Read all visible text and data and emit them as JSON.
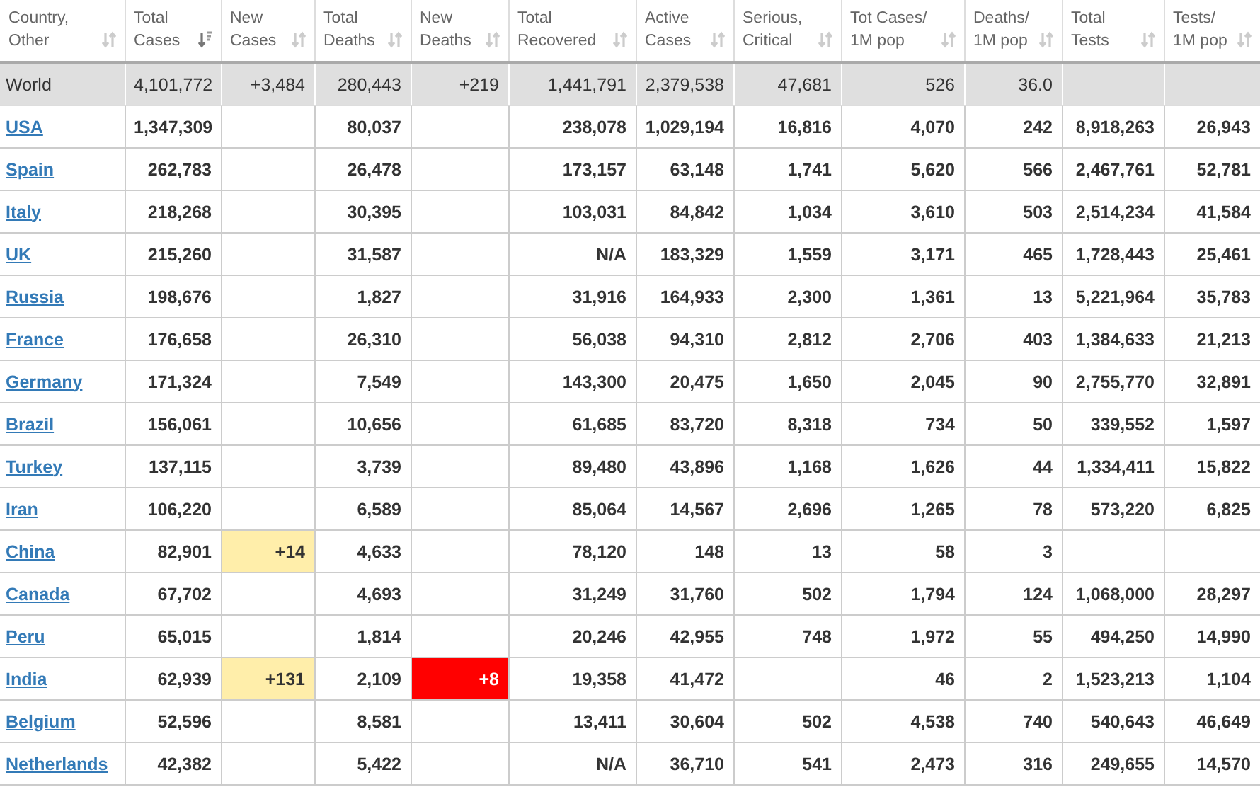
{
  "table": {
    "columns": [
      {
        "label": "Country,\nOther",
        "sorted": false
      },
      {
        "label": "Total\nCases",
        "sorted": true
      },
      {
        "label": "New\nCases",
        "sorted": false
      },
      {
        "label": "Total\nDeaths",
        "sorted": false
      },
      {
        "label": "New\nDeaths",
        "sorted": false
      },
      {
        "label": "Total\nRecovered",
        "sorted": false
      },
      {
        "label": "Active\nCases",
        "sorted": false
      },
      {
        "label": "Serious,\nCritical",
        "sorted": false
      },
      {
        "label": "Tot Cases/\n1M pop",
        "sorted": false
      },
      {
        "label": "Deaths/\n1M pop",
        "sorted": false
      },
      {
        "label": "Total\nTests",
        "sorted": false
      },
      {
        "label": "Tests/\n1M pop",
        "sorted": false
      }
    ],
    "rows": [
      {
        "kind": "world",
        "country": "World",
        "total_cases": "4,101,772",
        "new_cases": "+3,484",
        "total_deaths": "280,443",
        "new_deaths": "+219",
        "total_recovered": "1,441,791",
        "active_cases": "2,379,538",
        "serious_critical": "47,681",
        "tot_cases_per_1m": "526",
        "deaths_per_1m": "36.0",
        "new_cases_highlight": false,
        "new_deaths_highlight": false
      },
      {
        "kind": "country",
        "country": "USA",
        "total_cases": "1,347,309",
        "total_deaths": "80,037",
        "total_recovered": "238,078",
        "active_cases": "1,029,194",
        "serious_critical": "16,816",
        "tot_cases_per_1m": "4,070",
        "deaths_per_1m": "242",
        "total_tests": "8,918,263",
        "tests_per_1m": "26,943",
        "new_cases_highlight": false,
        "new_deaths_highlight": false
      },
      {
        "kind": "country",
        "country": "Spain",
        "total_cases": "262,783",
        "total_deaths": "26,478",
        "total_recovered": "173,157",
        "active_cases": "63,148",
        "serious_critical": "1,741",
        "tot_cases_per_1m": "5,620",
        "deaths_per_1m": "566",
        "total_tests": "2,467,761",
        "tests_per_1m": "52,781",
        "new_cases_highlight": false,
        "new_deaths_highlight": false
      },
      {
        "kind": "country",
        "country": "Italy",
        "total_cases": "218,268",
        "total_deaths": "30,395",
        "total_recovered": "103,031",
        "active_cases": "84,842",
        "serious_critical": "1,034",
        "tot_cases_per_1m": "3,610",
        "deaths_per_1m": "503",
        "total_tests": "2,514,234",
        "tests_per_1m": "41,584",
        "new_cases_highlight": false,
        "new_deaths_highlight": false
      },
      {
        "kind": "country",
        "country": "UK",
        "total_cases": "215,260",
        "total_deaths": "31,587",
        "total_recovered": "N/A",
        "active_cases": "183,329",
        "serious_critical": "1,559",
        "tot_cases_per_1m": "3,171",
        "deaths_per_1m": "465",
        "total_tests": "1,728,443",
        "tests_per_1m": "25,461",
        "new_cases_highlight": false,
        "new_deaths_highlight": false
      },
      {
        "kind": "country",
        "country": "Russia",
        "total_cases": "198,676",
        "total_deaths": "1,827",
        "total_recovered": "31,916",
        "active_cases": "164,933",
        "serious_critical": "2,300",
        "tot_cases_per_1m": "1,361",
        "deaths_per_1m": "13",
        "total_tests": "5,221,964",
        "tests_per_1m": "35,783",
        "new_cases_highlight": false,
        "new_deaths_highlight": false
      },
      {
        "kind": "country",
        "country": "France",
        "total_cases": "176,658",
        "total_deaths": "26,310",
        "total_recovered": "56,038",
        "active_cases": "94,310",
        "serious_critical": "2,812",
        "tot_cases_per_1m": "2,706",
        "deaths_per_1m": "403",
        "total_tests": "1,384,633",
        "tests_per_1m": "21,213",
        "new_cases_highlight": false,
        "new_deaths_highlight": false
      },
      {
        "kind": "country",
        "country": "Germany",
        "total_cases": "171,324",
        "total_deaths": "7,549",
        "total_recovered": "143,300",
        "active_cases": "20,475",
        "serious_critical": "1,650",
        "tot_cases_per_1m": "2,045",
        "deaths_per_1m": "90",
        "total_tests": "2,755,770",
        "tests_per_1m": "32,891",
        "new_cases_highlight": false,
        "new_deaths_highlight": false
      },
      {
        "kind": "country",
        "country": "Brazil",
        "total_cases": "156,061",
        "total_deaths": "10,656",
        "total_recovered": "61,685",
        "active_cases": "83,720",
        "serious_critical": "8,318",
        "tot_cases_per_1m": "734",
        "deaths_per_1m": "50",
        "total_tests": "339,552",
        "tests_per_1m": "1,597",
        "new_cases_highlight": false,
        "new_deaths_highlight": false
      },
      {
        "kind": "country",
        "country": "Turkey",
        "total_cases": "137,115",
        "total_deaths": "3,739",
        "total_recovered": "89,480",
        "active_cases": "43,896",
        "serious_critical": "1,168",
        "tot_cases_per_1m": "1,626",
        "deaths_per_1m": "44",
        "total_tests": "1,334,411",
        "tests_per_1m": "15,822",
        "new_cases_highlight": false,
        "new_deaths_highlight": false
      },
      {
        "kind": "country",
        "country": "Iran",
        "total_cases": "106,220",
        "total_deaths": "6,589",
        "total_recovered": "85,064",
        "active_cases": "14,567",
        "serious_critical": "2,696",
        "tot_cases_per_1m": "1,265",
        "deaths_per_1m": "78",
        "total_tests": "573,220",
        "tests_per_1m": "6,825",
        "new_cases_highlight": false,
        "new_deaths_highlight": false
      },
      {
        "kind": "country",
        "country": "China",
        "total_cases": "82,901",
        "new_cases": "+14",
        "total_deaths": "4,633",
        "total_recovered": "78,120",
        "active_cases": "148",
        "serious_critical": "13",
        "tot_cases_per_1m": "58",
        "deaths_per_1m": "3",
        "new_cases_highlight": true,
        "new_deaths_highlight": false
      },
      {
        "kind": "country",
        "country": "Canada",
        "total_cases": "67,702",
        "total_deaths": "4,693",
        "total_recovered": "31,249",
        "active_cases": "31,760",
        "serious_critical": "502",
        "tot_cases_per_1m": "1,794",
        "deaths_per_1m": "124",
        "total_tests": "1,068,000",
        "tests_per_1m": "28,297",
        "new_cases_highlight": false,
        "new_deaths_highlight": false
      },
      {
        "kind": "country",
        "country": "Peru",
        "total_cases": "65,015",
        "total_deaths": "1,814",
        "total_recovered": "20,246",
        "active_cases": "42,955",
        "serious_critical": "748",
        "tot_cases_per_1m": "1,972",
        "deaths_per_1m": "55",
        "total_tests": "494,250",
        "tests_per_1m": "14,990",
        "new_cases_highlight": false,
        "new_deaths_highlight": false
      },
      {
        "kind": "country",
        "country": "India",
        "total_cases": "62,939",
        "new_cases": "+131",
        "total_deaths": "2,109",
        "new_deaths": "+8",
        "total_recovered": "19,358",
        "active_cases": "41,472",
        "tot_cases_per_1m": "46",
        "deaths_per_1m": "2",
        "total_tests": "1,523,213",
        "tests_per_1m": "1,104",
        "new_cases_highlight": true,
        "new_deaths_highlight": true
      },
      {
        "kind": "country",
        "country": "Belgium",
        "total_cases": "52,596",
        "total_deaths": "8,581",
        "total_recovered": "13,411",
        "active_cases": "30,604",
        "serious_critical": "502",
        "tot_cases_per_1m": "4,538",
        "deaths_per_1m": "740",
        "total_tests": "540,643",
        "tests_per_1m": "46,649",
        "new_cases_highlight": false,
        "new_deaths_highlight": false
      },
      {
        "kind": "country",
        "country": "Netherlands",
        "total_cases": "42,382",
        "total_deaths": "5,422",
        "total_recovered": "N/A",
        "active_cases": "36,710",
        "serious_critical": "541",
        "tot_cases_per_1m": "2,473",
        "deaths_per_1m": "316",
        "total_tests": "249,655",
        "tests_per_1m": "14,570",
        "new_cases_highlight": false,
        "new_deaths_highlight": false
      }
    ]
  }
}
